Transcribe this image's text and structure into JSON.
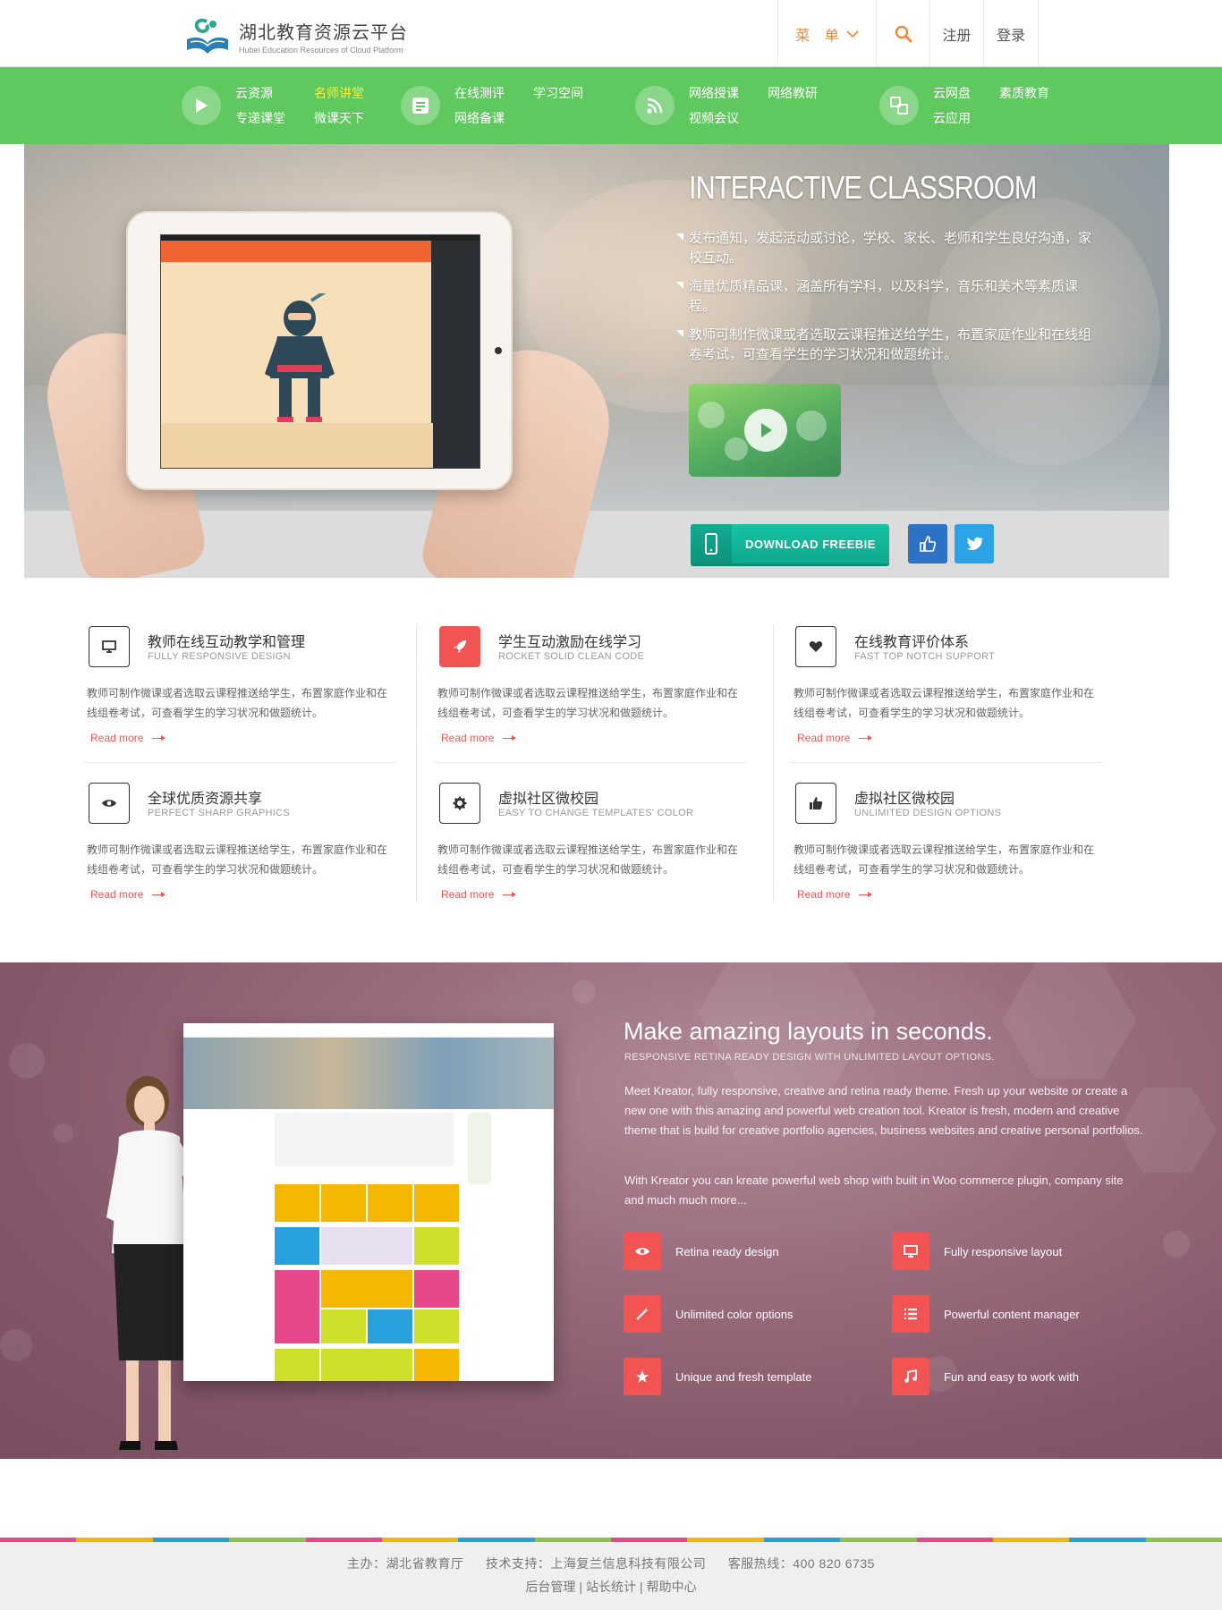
{
  "header": {
    "logo_cn": "湖北教育资源云平台",
    "logo_en": "Hubei Education Resources of Cloud Platform",
    "menu_label": "菜 单",
    "register": "注册",
    "login": "登录"
  },
  "green_nav": {
    "groups": [
      {
        "icon": "play-icon",
        "links": [
          "云资源",
          "名师讲堂",
          "专递课堂",
          "微课天下"
        ],
        "highlight": "名师讲堂"
      },
      {
        "icon": "notes-icon",
        "links": [
          "在线测评",
          "学习空间",
          "网络备课",
          ""
        ]
      },
      {
        "icon": "rss-icon",
        "links": [
          "网络授课",
          "网络教研",
          "视频会议",
          ""
        ]
      },
      {
        "icon": "apps-icon",
        "links": [
          "云网盘",
          "素质教育",
          "云应用",
          ""
        ]
      }
    ]
  },
  "hero": {
    "title": "INTERACTIVE CLASSROOM",
    "points": [
      "发布通知，发起活动或讨论，学校、家长、老师和学生良好沟通，家校互动。",
      "海量优质精品课，涵盖所有学科，以及科学，音乐和美术等素质课程。",
      "教师可制作微课或者选取云课程推送给学生，布置家庭作业和在线组卷考试，可查看学生的学习状况和做题统计。"
    ],
    "download_label": "DOWNLOAD FREEBIE"
  },
  "features": [
    {
      "icon": "monitor-icon",
      "title": "教师在线互动教学和管理",
      "subtitle": "FULLY RESPONSIVE DESIGN",
      "desc": "教师可制作微课或者选取云课程推送给学生，布置家庭作业和在线组卷考试，可查看学生的学习状况和做题统计。",
      "more": "Read more"
    },
    {
      "icon": "rocket-icon",
      "title": "学生互动激励在线学习",
      "subtitle": "ROCKET SOLID CLEAN CODE",
      "desc": "教师可制作微课或者选取云课程推送给学生，布置家庭作业和在线组卷考试，可查看学生的学习状况和做题统计。",
      "more": "Read more"
    },
    {
      "icon": "heart-icon",
      "title": "在线教育评价体系",
      "subtitle": "FAST TOP NOTCH SUPPORT",
      "desc": "教师可制作微课或者选取云课程推送给学生，布置家庭作业和在线组卷考试，可查看学生的学习状况和做题统计。",
      "more": "Read more"
    },
    {
      "icon": "eye-icon",
      "title": "全球优质资源共享",
      "subtitle": "PERFECT SHARP GRAPHICS",
      "desc": "教师可制作微课或者选取云课程推送给学生，布置家庭作业和在线组卷考试，可查看学生的学习状况和做题统计。",
      "more": "Read more"
    },
    {
      "icon": "gear-icon",
      "title": "虚拟社区微校园",
      "subtitle": "EASY TO CHANGE TEMPLATES' COLOR",
      "desc": "教师可制作微课或者选取云课程推送给学生，布置家庭作业和在线组卷考试，可查看学生的学习状况和做题统计。",
      "more": "Read more"
    },
    {
      "icon": "thumbs-up-icon",
      "title": "虚拟社区微校园",
      "subtitle": "UNLIMITED DESIGN OPTIONS",
      "desc": "教师可制作微课或者选取云课程推送给学生，布置家庭作业和在线组卷考试，可查看学生的学习状况和做题统计。",
      "more": "Read more"
    }
  ],
  "promo": {
    "title": "Make amazing layouts in seconds.",
    "subtitle": "RESPONSIVE RETINA READY DESIGN WITH UNLIMITED LAYOUT OPTIONS.",
    "p1": "Meet Kreator, fully responsive, creative and retina ready theme. Fresh up your website or create a new one with this amazing and powerful web creation tool. Kreator is fresh, modern and creative theme that is build for creative portfolio agencies, business websites and creative personal portfolios.",
    "p2": "With Kreator you can kreate powerful web shop with built in Woo commerce plugin, company site and much much more...",
    "features": [
      {
        "icon": "eye-icon",
        "label": "Retina ready design"
      },
      {
        "icon": "monitor-icon",
        "label": "Fully responsive layout"
      },
      {
        "icon": "magic-wand-icon",
        "label": "Unlimited color options"
      },
      {
        "icon": "list-icon",
        "label": "Powerful content manager"
      },
      {
        "icon": "star-icon",
        "label": "Unique and fresh template"
      },
      {
        "icon": "music-icon",
        "label": "Fun and easy to work with"
      }
    ]
  },
  "footer": {
    "host": "主办：湖北省教育厅",
    "support": "技术支持：上海复兰信息科技有限公司",
    "hotline": "客服热线：400 820 6735",
    "links": [
      "后台管理",
      "站长统计",
      "帮助中心"
    ]
  },
  "colors": {
    "green": "#5fc85e",
    "accent_red": "#f25454",
    "accent_orange": "#f0883a",
    "teal": "#16c3a4",
    "promo_bg": "#8e6275"
  }
}
